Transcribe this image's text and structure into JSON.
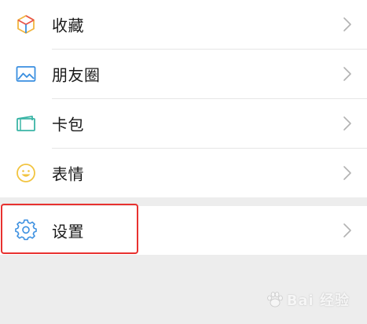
{
  "menu": {
    "items": [
      {
        "label": "收藏",
        "icon": "favorites-cube-icon"
      },
      {
        "label": "朋友圈",
        "icon": "moments-photo-icon"
      },
      {
        "label": "卡包",
        "icon": "card-wallet-icon"
      },
      {
        "label": "表情",
        "icon": "sticker-smiley-icon"
      }
    ],
    "settings": {
      "label": "设置",
      "icon": "gear-icon"
    }
  },
  "highlight_color": "#e8312f",
  "watermark": {
    "text": "Bai 经验"
  }
}
